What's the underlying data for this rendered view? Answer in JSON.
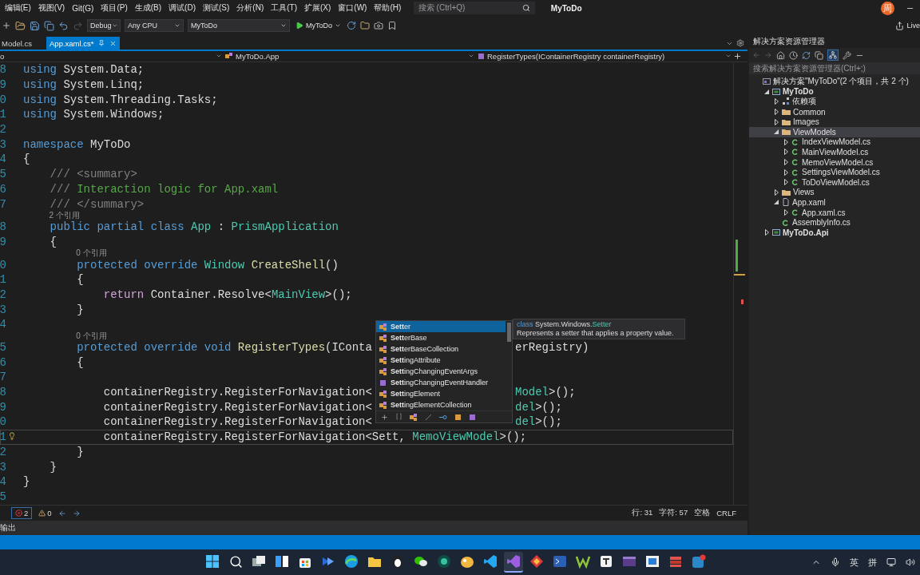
{
  "menu_bar": {
    "items": [
      "编辑(E)",
      "视图(V)",
      "Git(G)",
      "项目(P)",
      "生成(B)",
      "调试(D)",
      "测试(S)",
      "分析(N)",
      "工具(T)",
      "扩展(X)",
      "窗口(W)",
      "帮助(H)"
    ],
    "search": {
      "placeholder": "搜索 (Ctrl+Q)"
    },
    "title": "MyToDo",
    "avatar": "周"
  },
  "toolbar": {
    "configuration": "Debug",
    "platform": "Any CPU",
    "startup_project": "MyToDo",
    "run_button": "MyToDo",
    "live_share": "Live"
  },
  "tabs": [
    {
      "label": "Model.cs",
      "selected": false
    },
    {
      "label": "App.xaml.cs*",
      "selected": true
    }
  ],
  "nav_bar": {
    "project": "o",
    "type": "MyToDo.App",
    "member": "RegisterTypes(IContainerRegistry containerRegistry)"
  },
  "editor": {
    "lines": [
      {
        "number": "8",
        "current": false,
        "tokens": [
          {
            "kind": "keyword",
            "text": "using"
          },
          {
            "kind": "plain",
            "text": " System.Data;"
          }
        ]
      },
      {
        "number": "9",
        "current": false,
        "tokens": [
          {
            "kind": "keyword",
            "text": "using"
          },
          {
            "kind": "plain",
            "text": " System.Linq;"
          }
        ]
      },
      {
        "number": "0",
        "current": false,
        "tokens": [
          {
            "kind": "keyword",
            "text": "using"
          },
          {
            "kind": "plain",
            "text": " System.Threading.Tasks;"
          }
        ]
      },
      {
        "number": "1",
        "current": false,
        "tokens": [
          {
            "kind": "keyword",
            "text": "using"
          },
          {
            "kind": "plain",
            "text": " System.Windows;"
          }
        ]
      },
      {
        "number": "2",
        "current": false
      },
      {
        "number": "3",
        "current": false,
        "tokens": [
          {
            "kind": "keyword",
            "text": "namespace"
          },
          {
            "kind": "plain",
            "text": " MyToDo"
          }
        ]
      },
      {
        "number": "4",
        "current": false,
        "tokens": [
          {
            "kind": "plain",
            "text": "{"
          }
        ]
      },
      {
        "number": "5",
        "current": false,
        "tokens": [
          {
            "kind": "doc",
            "text": "    /// <summary>"
          }
        ]
      },
      {
        "number": "6",
        "current": false,
        "tokens": [
          {
            "kind": "doc",
            "text": "    ///"
          },
          {
            "kind": "comment",
            "text": " Interaction logic for App.xaml"
          }
        ]
      },
      {
        "number": "7",
        "current": false,
        "tokens": [
          {
            "kind": "doc",
            "text": "    /// </summary>"
          }
        ]
      },
      {
        "number": "8",
        "current": false,
        "lens": "2 个引用",
        "tokens": [
          {
            "kind": "keyword",
            "text": "    public partial class "
          },
          {
            "kind": "type",
            "text": "App"
          },
          {
            "kind": "plain",
            "text": " : "
          },
          {
            "kind": "type",
            "text": "PrismApplication"
          }
        ]
      },
      {
        "number": "9",
        "current": false,
        "tokens": [
          {
            "kind": "plain",
            "text": "    {"
          }
        ]
      },
      {
        "number": "0",
        "current": false,
        "lens": "0 个引用",
        "tokens": [
          {
            "kind": "keyword",
            "text": "        protected override "
          },
          {
            "kind": "type",
            "text": "Window"
          },
          {
            "kind": "method",
            "text": " CreateShell"
          },
          {
            "kind": "plain",
            "text": "()"
          }
        ]
      },
      {
        "number": "1",
        "current": false,
        "tokens": [
          {
            "kind": "plain",
            "text": "        {"
          }
        ]
      },
      {
        "number": "2",
        "current": false,
        "tokens": [
          {
            "kind": "control",
            "text": "            return"
          },
          {
            "kind": "plain",
            "text": " Container.Resolve<"
          },
          {
            "kind": "type",
            "text": "MainView"
          },
          {
            "kind": "plain",
            "text": ">();"
          }
        ]
      },
      {
        "number": "3",
        "current": false,
        "tokens": [
          {
            "kind": "plain",
            "text": "        }"
          }
        ]
      },
      {
        "number": "4",
        "current": false
      },
      {
        "number": "5",
        "current": false,
        "lens": "0 个引用",
        "tokens": [
          {
            "kind": "keyword",
            "text": "        protected override void "
          },
          {
            "kind": "method",
            "text": "RegisterTypes"
          },
          {
            "kind": "plain",
            "text": "(IConta"
          }
        ],
        "tail": [
          {
            "kind": "plain",
            "text": "erRegistry)"
          }
        ]
      },
      {
        "number": "6",
        "current": false,
        "tokens": [
          {
            "kind": "plain",
            "text": "        {"
          }
        ]
      },
      {
        "number": "7",
        "current": false
      },
      {
        "number": "8",
        "current": false,
        "tokens": [
          {
            "kind": "plain",
            "text": "            containerRegistry.RegisterForNavigation<"
          }
        ],
        "tail": [
          {
            "kind": "type",
            "text": "Model"
          },
          {
            "kind": "plain",
            "text": ">();"
          }
        ]
      },
      {
        "number": "9",
        "current": false,
        "tokens": [
          {
            "kind": "plain",
            "text": "            containerRegistry.RegisterForNavigation<"
          }
        ],
        "tail": [
          {
            "kind": "type",
            "text": "del"
          },
          {
            "kind": "plain",
            "text": ">();"
          }
        ]
      },
      {
        "number": "0",
        "current": false,
        "tokens": [
          {
            "kind": "plain",
            "text": "            containerRegistry.RegisterForNavigation<"
          }
        ],
        "tail": [
          {
            "kind": "type",
            "text": "del"
          },
          {
            "kind": "plain",
            "text": ">();"
          }
        ]
      },
      {
        "number": "1",
        "current": true,
        "tokens": [
          {
            "kind": "plain",
            "text": "            containerRegistry.RegisterForNavigation<Sett, "
          },
          {
            "kind": "type",
            "text": "MemoViewModel"
          },
          {
            "kind": "plain",
            "text": ">();"
          }
        ]
      },
      {
        "number": "2",
        "current": false,
        "tokens": [
          {
            "kind": "plain",
            "text": "        }"
          }
        ]
      },
      {
        "number": "3",
        "current": false,
        "tokens": [
          {
            "kind": "plain",
            "text": "    }"
          }
        ]
      },
      {
        "number": "4",
        "current": false,
        "tokens": [
          {
            "kind": "plain",
            "text": "}"
          }
        ]
      },
      {
        "number": "5",
        "current": false
      }
    ]
  },
  "completion": {
    "items": [
      {
        "label": "**Sett**er",
        "kind": "class",
        "selected": true
      },
      {
        "label": "**Sett**erBase",
        "kind": "class",
        "selected": false
      },
      {
        "label": "**Sett**erBaseCollection",
        "kind": "class",
        "selected": false
      },
      {
        "label": "**Sett**ingAttribute",
        "kind": "class",
        "selected": false
      },
      {
        "label": "**Sett**ingChangingEventArgs",
        "kind": "class",
        "selected": false
      },
      {
        "label": "**Sett**ingChangingEventHandler",
        "kind": "delegate",
        "selected": false
      },
      {
        "label": "**Sett**ingElement",
        "kind": "class",
        "selected": false
      },
      {
        "label": "**Sett**ingElementCollection",
        "kind": "class",
        "selected": false
      }
    ],
    "tooltip": {
      "signature": [
        {
          "kind": "keyword",
          "text": "class"
        },
        {
          "kind": "plain",
          "text": " System.Windows."
        },
        {
          "kind": "type",
          "text": "Setter"
        }
      ],
      "description": "Represents a setter that applies a property value."
    }
  },
  "status": {
    "errors": "2",
    "warnings": "0",
    "line": "行: 31",
    "column": "字符: 57",
    "indent": "空格",
    "line_ending": "CRLF"
  },
  "output_tab": "输出",
  "solution_explorer": {
    "title": "解决方案资源管理器",
    "search": {
      "placeholder": "搜索解决方案资源管理器(Ctrl+;)"
    },
    "tree": [
      {
        "label": "解决方案\"MyToDo\"(2 个项目，共 2 个)",
        "kind": "solution",
        "selected": false,
        "children": [
          {
            "label": "MyToDo",
            "kind": "project",
            "selected": false,
            "expanded": true,
            "children": [
              {
                "label": "依赖项",
                "kind": "deps",
                "selected": false,
                "expanded": false
              },
              {
                "label": "Common",
                "kind": "folder",
                "selected": false,
                "expanded": false
              },
              {
                "label": "Images",
                "kind": "folder",
                "selected": false,
                "expanded": false
              },
              {
                "label": "ViewModels",
                "kind": "folder",
                "selected": true,
                "expanded": true,
                "children": [
                  {
                    "label": "IndexViewModel.cs",
                    "kind": "cs",
                    "selected": false,
                    "expanded": false
                  },
                  {
                    "label": "MainViewModel.cs",
                    "kind": "cs",
                    "selected": false,
                    "expanded": false
                  },
                  {
                    "label": "MemoViewModel.cs",
                    "kind": "cs",
                    "selected": false,
                    "expanded": false
                  },
                  {
                    "label": "SettingsViewModel.cs",
                    "kind": "cs",
                    "selected": false,
                    "expanded": false
                  },
                  {
                    "label": "ToDoViewModel.cs",
                    "kind": "cs",
                    "selected": false,
                    "expanded": false
                  }
                ]
              },
              {
                "label": "Views",
                "kind": "folder",
                "selected": false,
                "expanded": false
              },
              {
                "label": "App.xaml",
                "kind": "xaml",
                "selected": false,
                "expanded": true,
                "children": [
                  {
                    "label": "App.xaml.cs",
                    "kind": "cs",
                    "selected": false,
                    "expanded": false
                  }
                ]
              },
              {
                "label": "AssemblyInfo.cs",
                "kind": "cs",
                "selected": false
              }
            ]
          },
          {
            "label": "MyToDo.Api",
            "kind": "project",
            "selected": false,
            "expanded": false
          }
        ]
      }
    ]
  },
  "taskbar": {
    "items": [
      {
        "selected": false
      },
      {
        "selected": false
      },
      {
        "selected": false
      },
      {
        "selected": false
      },
      {
        "selected": false
      },
      {
        "selected": false
      },
      {
        "selected": false
      },
      {
        "selected": false
      },
      {
        "selected": false
      },
      {
        "selected": false
      },
      {
        "selected": false
      },
      {
        "selected": false
      },
      {
        "selected": false
      },
      {
        "selected": true
      },
      {
        "selected": false
      },
      {
        "selected": false
      },
      {
        "selected": false
      },
      {
        "selected": false
      },
      {
        "selected": false
      },
      {
        "selected": false
      },
      {
        "selected": false
      },
      {
        "selected": false
      }
    ],
    "tray": [
      "英",
      "拼"
    ]
  }
}
